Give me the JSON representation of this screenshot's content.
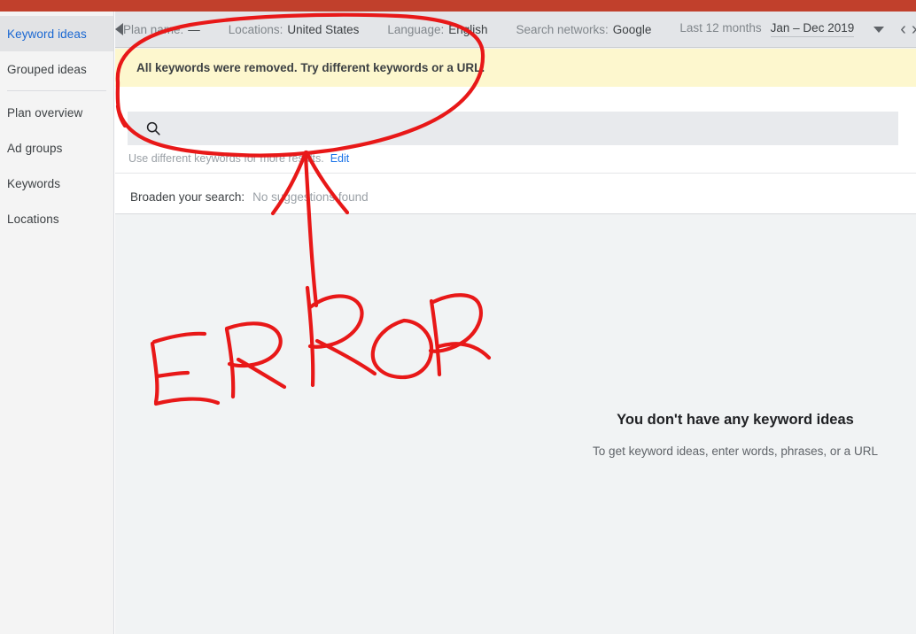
{
  "colors": {
    "top_bar_red": "#c1402c",
    "sidebar_bg": "#f4f4f4",
    "sidebar_selected_bg": "#e2e3e5",
    "sidebar_selected_text": "#1967d2",
    "toolbar_bg": "#e3e5e8",
    "warning_banner_bg": "#fdf7ce",
    "search_box_bg": "#e8eaed",
    "content_bg": "#f1f3f4",
    "link_blue": "#1a73e8",
    "annotation_red": "#e81818"
  },
  "sidebar": {
    "items": [
      {
        "label": "Keyword ideas",
        "selected": true
      },
      {
        "label": "Grouped ideas",
        "selected": false
      },
      {
        "label": "Plan overview",
        "selected": false
      },
      {
        "label": "Ad groups",
        "selected": false
      },
      {
        "label": "Keywords",
        "selected": false
      },
      {
        "label": "Locations",
        "selected": false
      }
    ]
  },
  "toolbar": {
    "collapse_icon": "caret-left-icon",
    "chips": [
      {
        "label": "Plan name:",
        "value": "—"
      },
      {
        "label": "Locations:",
        "value": "United States"
      },
      {
        "label": "Language:",
        "value": "English"
      },
      {
        "label": "Search networks:",
        "value": "Google"
      }
    ],
    "date_range": {
      "label": "Last 12 months",
      "value": "Jan – Dec 2019",
      "dropdown_icon": "caret-down-icon"
    },
    "prev_icon": "chevron-left-icon",
    "next_icon": "chevron-right-icon"
  },
  "card": {
    "warning": "All keywords were removed. Try different keywords or a URL.",
    "search": {
      "icon": "search-icon",
      "value": "",
      "placeholder": ""
    },
    "hint": {
      "text": "Use different keywords for more results.",
      "edit_label": "Edit"
    },
    "broaden": {
      "label": "Broaden your search:",
      "value": "No suggestions found"
    }
  },
  "empty_state": {
    "title": "You don't have any keyword ideas",
    "subtitle": "To get keyword ideas, enter words, phrases, or a URL"
  },
  "annotation": {
    "ellipse_label": "red-circle-around-search-area",
    "arrow_label": "red-arrow-pointing-to-search",
    "text": "ERROR"
  }
}
